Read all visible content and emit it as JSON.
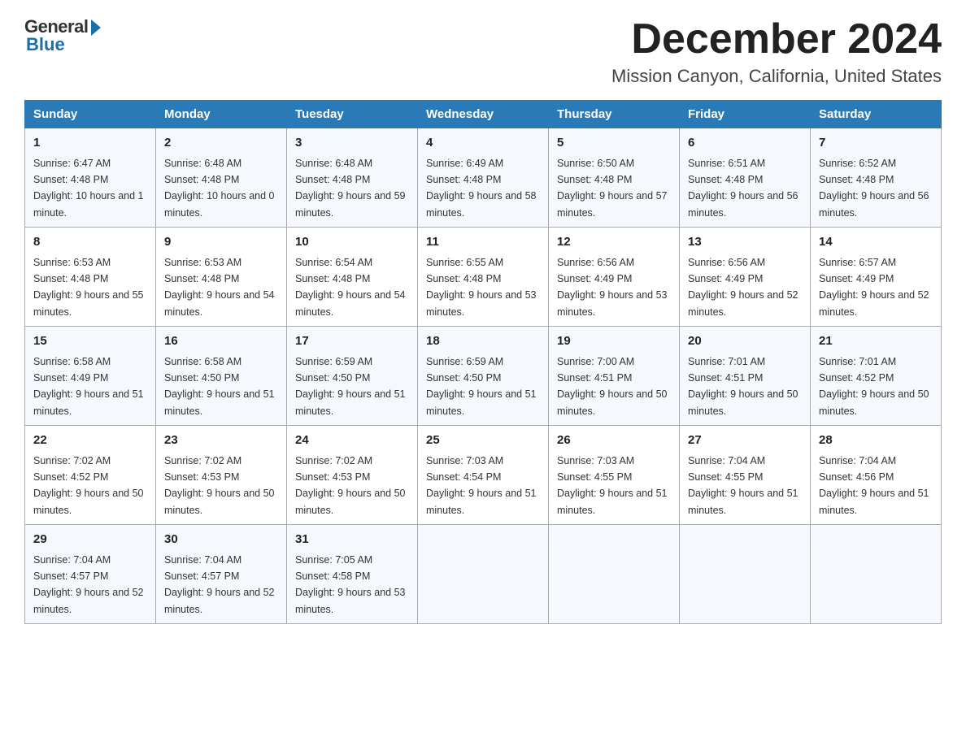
{
  "header": {
    "logo_general": "General",
    "logo_blue": "Blue",
    "month_title": "December 2024",
    "location": "Mission Canyon, California, United States"
  },
  "weekdays": [
    "Sunday",
    "Monday",
    "Tuesday",
    "Wednesday",
    "Thursday",
    "Friday",
    "Saturday"
  ],
  "weeks": [
    [
      {
        "day": "1",
        "sunrise": "6:47 AM",
        "sunset": "4:48 PM",
        "daylight": "10 hours and 1 minute."
      },
      {
        "day": "2",
        "sunrise": "6:48 AM",
        "sunset": "4:48 PM",
        "daylight": "10 hours and 0 minutes."
      },
      {
        "day": "3",
        "sunrise": "6:48 AM",
        "sunset": "4:48 PM",
        "daylight": "9 hours and 59 minutes."
      },
      {
        "day": "4",
        "sunrise": "6:49 AM",
        "sunset": "4:48 PM",
        "daylight": "9 hours and 58 minutes."
      },
      {
        "day": "5",
        "sunrise": "6:50 AM",
        "sunset": "4:48 PM",
        "daylight": "9 hours and 57 minutes."
      },
      {
        "day": "6",
        "sunrise": "6:51 AM",
        "sunset": "4:48 PM",
        "daylight": "9 hours and 56 minutes."
      },
      {
        "day": "7",
        "sunrise": "6:52 AM",
        "sunset": "4:48 PM",
        "daylight": "9 hours and 56 minutes."
      }
    ],
    [
      {
        "day": "8",
        "sunrise": "6:53 AM",
        "sunset": "4:48 PM",
        "daylight": "9 hours and 55 minutes."
      },
      {
        "day": "9",
        "sunrise": "6:53 AM",
        "sunset": "4:48 PM",
        "daylight": "9 hours and 54 minutes."
      },
      {
        "day": "10",
        "sunrise": "6:54 AM",
        "sunset": "4:48 PM",
        "daylight": "9 hours and 54 minutes."
      },
      {
        "day": "11",
        "sunrise": "6:55 AM",
        "sunset": "4:48 PM",
        "daylight": "9 hours and 53 minutes."
      },
      {
        "day": "12",
        "sunrise": "6:56 AM",
        "sunset": "4:49 PM",
        "daylight": "9 hours and 53 minutes."
      },
      {
        "day": "13",
        "sunrise": "6:56 AM",
        "sunset": "4:49 PM",
        "daylight": "9 hours and 52 minutes."
      },
      {
        "day": "14",
        "sunrise": "6:57 AM",
        "sunset": "4:49 PM",
        "daylight": "9 hours and 52 minutes."
      }
    ],
    [
      {
        "day": "15",
        "sunrise": "6:58 AM",
        "sunset": "4:49 PM",
        "daylight": "9 hours and 51 minutes."
      },
      {
        "day": "16",
        "sunrise": "6:58 AM",
        "sunset": "4:50 PM",
        "daylight": "9 hours and 51 minutes."
      },
      {
        "day": "17",
        "sunrise": "6:59 AM",
        "sunset": "4:50 PM",
        "daylight": "9 hours and 51 minutes."
      },
      {
        "day": "18",
        "sunrise": "6:59 AM",
        "sunset": "4:50 PM",
        "daylight": "9 hours and 51 minutes."
      },
      {
        "day": "19",
        "sunrise": "7:00 AM",
        "sunset": "4:51 PM",
        "daylight": "9 hours and 50 minutes."
      },
      {
        "day": "20",
        "sunrise": "7:01 AM",
        "sunset": "4:51 PM",
        "daylight": "9 hours and 50 minutes."
      },
      {
        "day": "21",
        "sunrise": "7:01 AM",
        "sunset": "4:52 PM",
        "daylight": "9 hours and 50 minutes."
      }
    ],
    [
      {
        "day": "22",
        "sunrise": "7:02 AM",
        "sunset": "4:52 PM",
        "daylight": "9 hours and 50 minutes."
      },
      {
        "day": "23",
        "sunrise": "7:02 AM",
        "sunset": "4:53 PM",
        "daylight": "9 hours and 50 minutes."
      },
      {
        "day": "24",
        "sunrise": "7:02 AM",
        "sunset": "4:53 PM",
        "daylight": "9 hours and 50 minutes."
      },
      {
        "day": "25",
        "sunrise": "7:03 AM",
        "sunset": "4:54 PM",
        "daylight": "9 hours and 51 minutes."
      },
      {
        "day": "26",
        "sunrise": "7:03 AM",
        "sunset": "4:55 PM",
        "daylight": "9 hours and 51 minutes."
      },
      {
        "day": "27",
        "sunrise": "7:04 AM",
        "sunset": "4:55 PM",
        "daylight": "9 hours and 51 minutes."
      },
      {
        "day": "28",
        "sunrise": "7:04 AM",
        "sunset": "4:56 PM",
        "daylight": "9 hours and 51 minutes."
      }
    ],
    [
      {
        "day": "29",
        "sunrise": "7:04 AM",
        "sunset": "4:57 PM",
        "daylight": "9 hours and 52 minutes."
      },
      {
        "day": "30",
        "sunrise": "7:04 AM",
        "sunset": "4:57 PM",
        "daylight": "9 hours and 52 minutes."
      },
      {
        "day": "31",
        "sunrise": "7:05 AM",
        "sunset": "4:58 PM",
        "daylight": "9 hours and 53 minutes."
      },
      null,
      null,
      null,
      null
    ]
  ]
}
